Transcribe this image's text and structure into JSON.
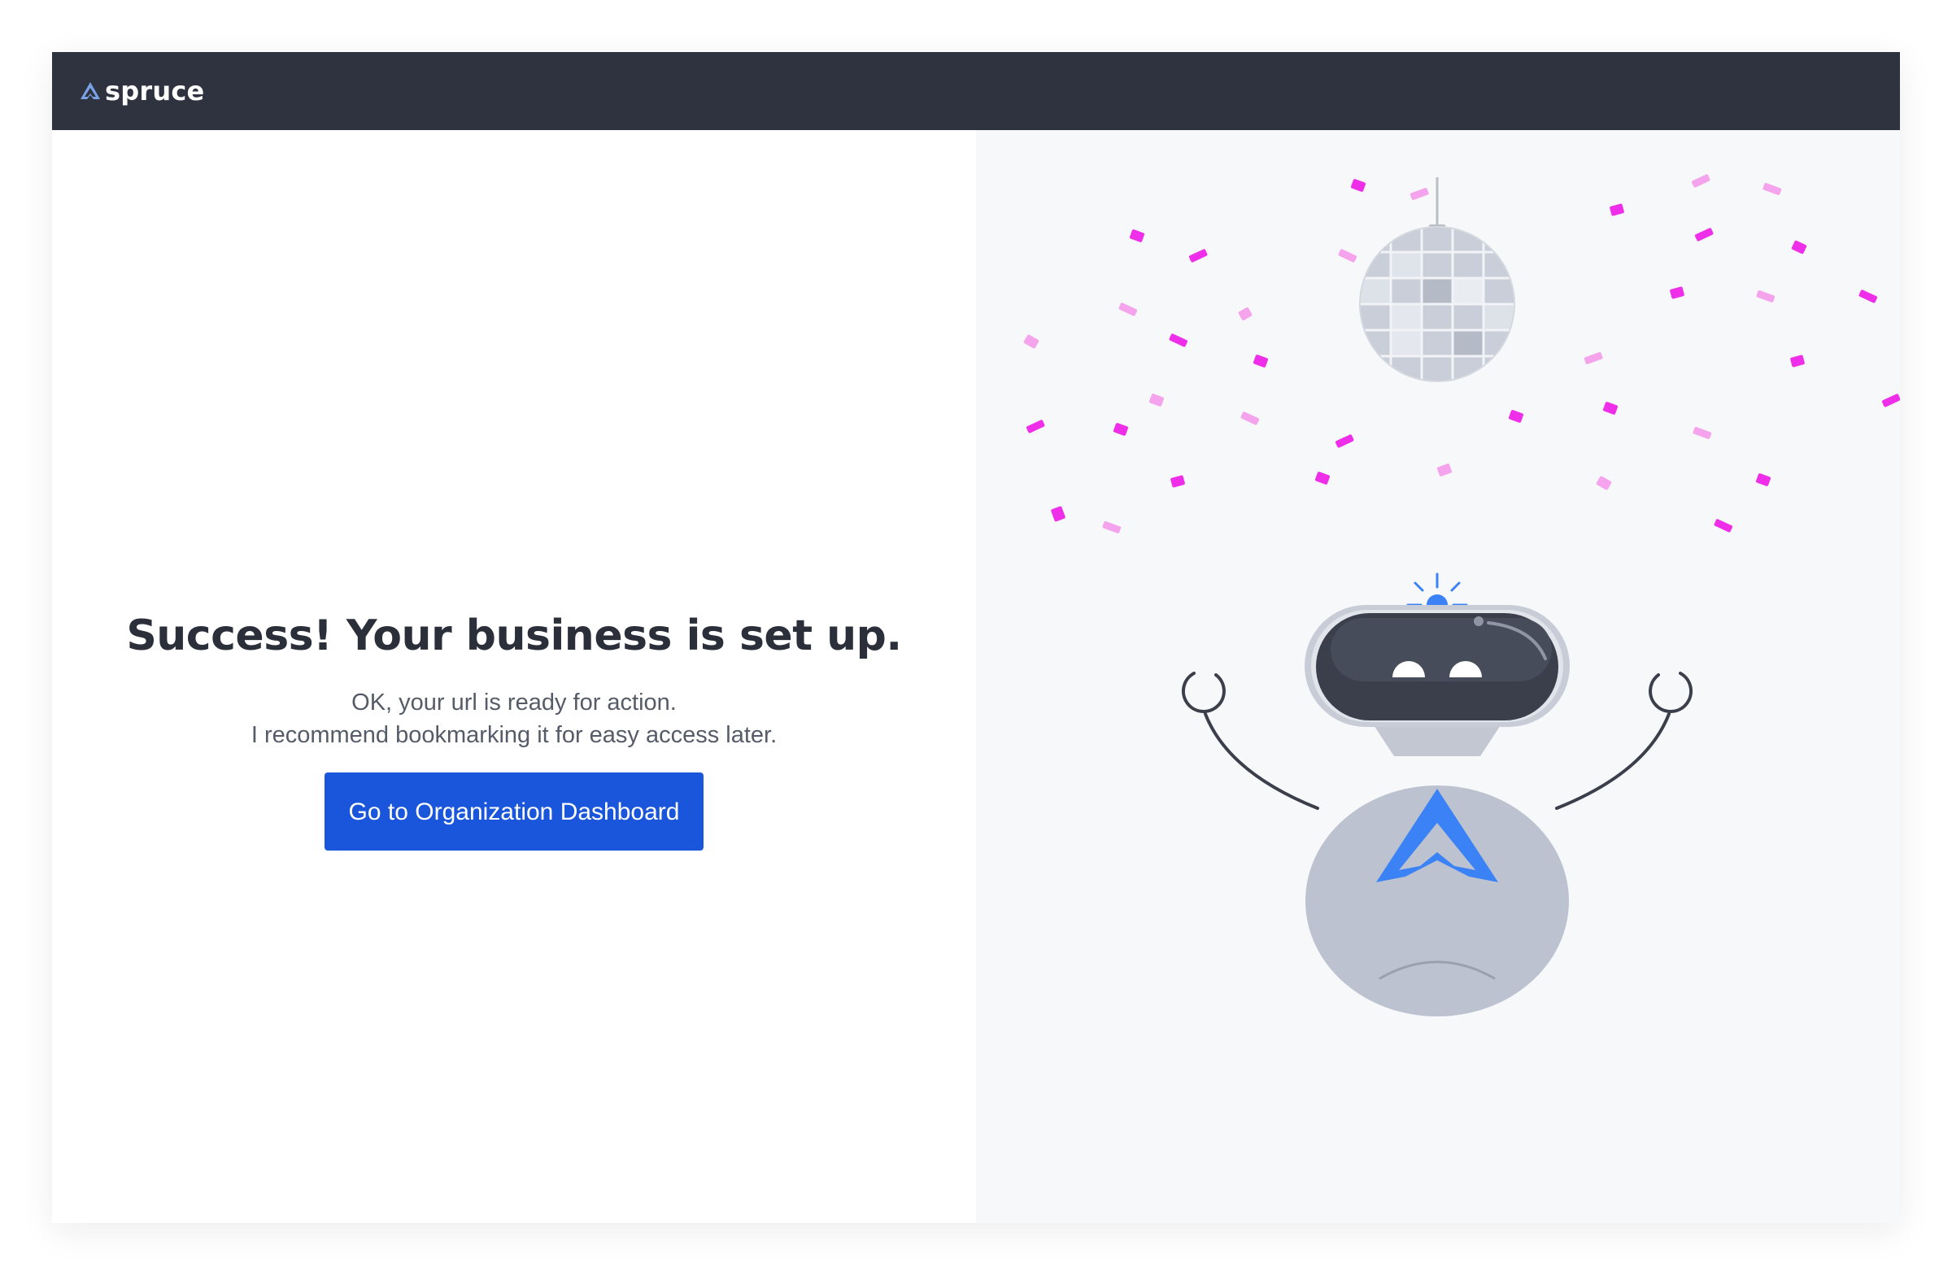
{
  "app": {
    "brand_name": "spruce",
    "brand_icon": "spruce-logo-icon"
  },
  "success": {
    "title": "Success! Your business is set up.",
    "line1": "OK, your url is ready for action.",
    "line2": "I recommend bookmarking it for easy access later.",
    "cta_label": "Go to Organization Dashboard"
  },
  "illustration": {
    "name": "celebrating-robot-illustration",
    "elements": [
      "disco-ball-icon",
      "confetti",
      "antenna-light-icon",
      "robot-head",
      "robot-body",
      "spruce-logo-icon"
    ]
  },
  "colors": {
    "topbar_bg": "#2e333f",
    "accent": "#1a56db",
    "logo_blue": "#3b82f6",
    "confetti_magenta": "#ee2ee8",
    "confetti_pink": "#f4a3ec",
    "illustration_bg": "#f7f8fa"
  }
}
